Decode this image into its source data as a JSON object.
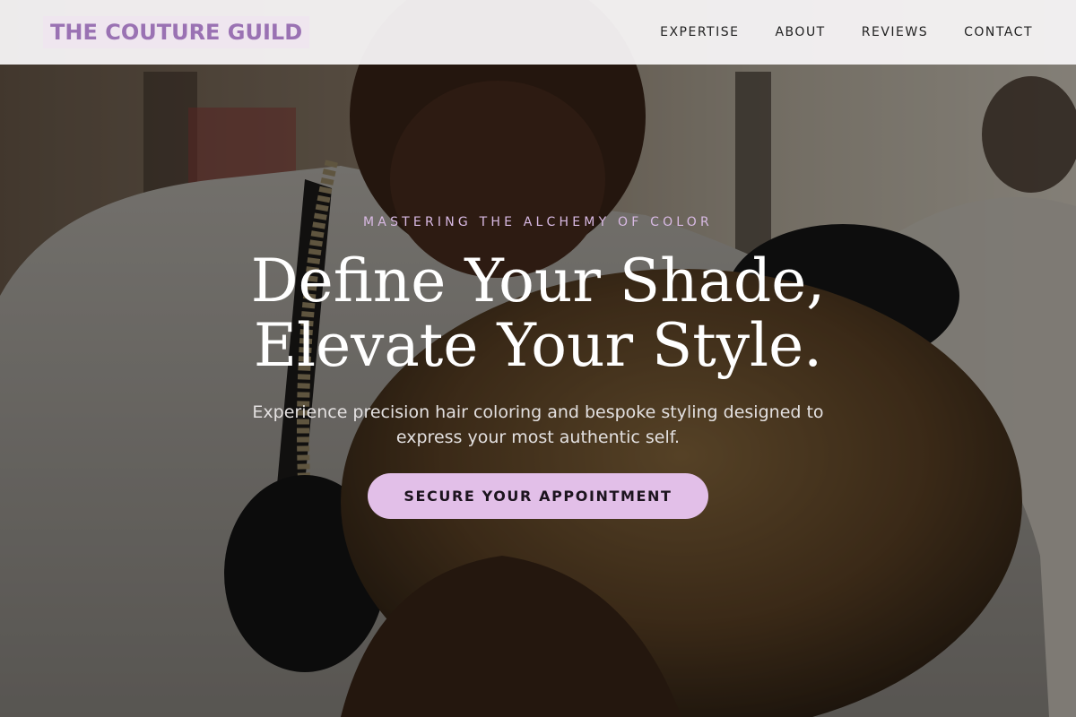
{
  "brand": {
    "name": "THE COUTURE GUILD",
    "color": "#9a72b3"
  },
  "nav": {
    "items": [
      {
        "label": "EXPERTISE"
      },
      {
        "label": "ABOUT"
      },
      {
        "label": "REVIEWS"
      },
      {
        "label": "CONTACT"
      }
    ]
  },
  "hero": {
    "eyebrow": "MASTERING THE ALCHEMY OF COLOR",
    "title_line1": "Define Your Shade,",
    "title_line2": "Elevate Your Style.",
    "subtitle": "Experience precision hair coloring and bespoke styling designed to express your most authentic self.",
    "cta_label": "SECURE YOUR APPOINTMENT",
    "background_image": "barber-styling-client-photo"
  },
  "colors": {
    "accent": "#e2bfe8",
    "eyebrow": "#d8b9e3",
    "header_bg": "#f5f3f4"
  }
}
